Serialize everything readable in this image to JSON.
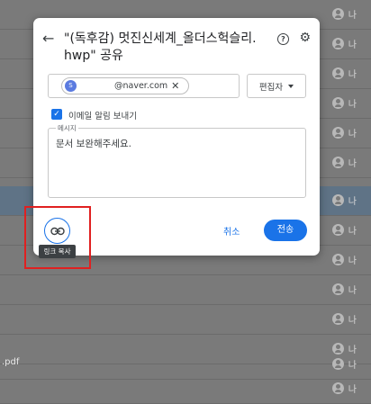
{
  "background": {
    "owner_label": "나",
    "file_label": ".pdf",
    "row_count": 13
  },
  "dialog": {
    "title": "\"(독후감) 멋진신세계_올더스헉슬리.hwp\" 공유",
    "recipient": {
      "avatar_letter": "S",
      "email_suffix": "@naver.com"
    },
    "role_select": "편집자",
    "notify_checkbox_label": "이메일 알림 보내기",
    "message_legend": "메시지",
    "message_text": "문서 보완해주세요.",
    "copy_link_tooltip": "링크 복사",
    "cancel_label": "취소",
    "send_label": "전송"
  },
  "colors": {
    "accent": "#1a73e8",
    "highlight": "#e02020"
  }
}
